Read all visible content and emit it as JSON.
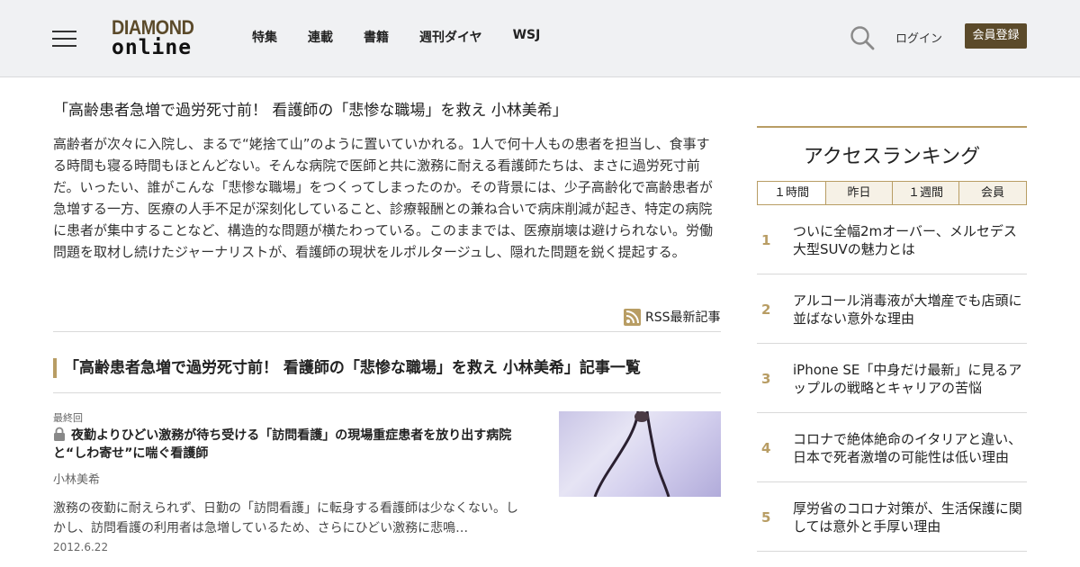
{
  "header": {
    "logo_line1": "DIAMOND",
    "logo_line2": "online",
    "nav": [
      "特集",
      "連載",
      "書籍",
      "週刊ダイヤ",
      "WSJ"
    ],
    "login_label": "ログイン",
    "register_label": "会員登録",
    "icons": {
      "menu": "hamburger-icon",
      "search": "search-icon"
    }
  },
  "series": {
    "title": "「高齢患者急増で過労死寸前！ 看護師の「悲惨な職場」を救え 小林美希」",
    "description": "高齢者が次々に入院し、まるで“姥捨て山”のように置いていかれる。1人で何十人もの患者を担当し、食事する時間も寝る時間もほとんどない。そんな病院で医師と共に激務に耐える看護師たちは、まさに過労死寸前だ。いったい、誰がこんな「悲惨な職場」をつくってしまったのか。その背景には、少子高齢化で高齢患者が急増する一方、医療の人手不足が深刻化していること、診療報酬との兼ね合いで病床削減が起き、特定の病院に患者が集中することなど、構造的な問題が横たわっている。このままでは、医療崩壊は避けられない。労働問題を取材し続けたジャーナリストが、看護師の現状をルポルタージュし、隠れた問題を鋭く提起する。",
    "rss_label": "RSS最新記事",
    "list_heading": "「高齢患者急増で過労死寸前！ 看護師の「悲惨な職場」を救え 小林美希」記事一覧"
  },
  "articles": [
    {
      "label": "最終回",
      "title": "夜勤よりひどい激務が待ち受ける「訪問看護」の現場重症患者を放り出す病院と“しわ寄せ”に喘ぐ看護師",
      "author": "小林美希",
      "excerpt": "激務の夜勤に耐えられず、日勤の「訪問看護」に転身する看護師は少なくない。しかし、訪問看護の利用者は急増しているため、さらにひどい激務に悲鳴…",
      "date": "2012.6.22",
      "locked": true
    }
  ],
  "sidebar": {
    "title": "アクセスランキング",
    "tabs": [
      "１時間",
      "昨日",
      "１週間",
      "会員"
    ],
    "active_tab": 0,
    "ranking": [
      {
        "rank": "1",
        "title": "ついに全幅2mオーバー、メルセデス大型SUVの魅力とは"
      },
      {
        "rank": "2",
        "title": "アルコール消毒液が大増産でも店頭に並ばない意外な理由"
      },
      {
        "rank": "3",
        "title": "iPhone SE「中身だけ最新」に見るアップルの戦略とキャリアの苦悩"
      },
      {
        "rank": "4",
        "title": "コロナで絶体絶命のイタリアと違い、日本で死者激増の可能性は低い理由"
      },
      {
        "rank": "5",
        "title": "厚労省のコロナ対策が、生活保護に関しては意外と手厚い理由"
      }
    ]
  },
  "colors": {
    "brand_gold": "#b89d64",
    "brand_brown": "#5b4a2a",
    "header_bg": "#f0f1f3"
  }
}
